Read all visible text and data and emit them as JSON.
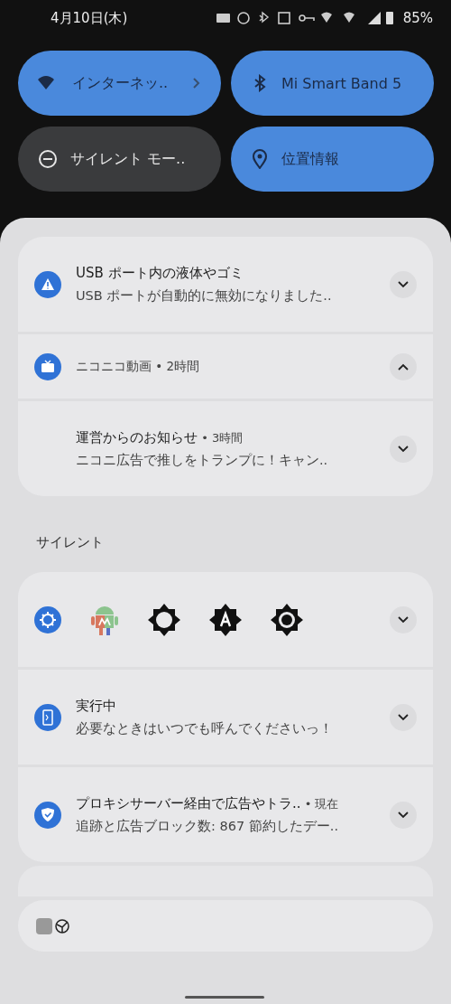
{
  "status_bar": {
    "date": "4月10日(木)",
    "battery": "85%"
  },
  "tiles": [
    {
      "label": "インターネッ..",
      "on": true
    },
    {
      "label": "Mi Smart Band 5",
      "on": true
    },
    {
      "label": "サイレント モー..",
      "on": false
    },
    {
      "label": "位置情報",
      "on": true
    }
  ],
  "alerting": [
    {
      "kind": "single",
      "title": "USB ポート内の液体やゴミ",
      "text": "USB ポートが自動的に無効になりました..",
      "expanded": false
    },
    {
      "kind": "group",
      "header": "ニコニコ動画 • 2時間",
      "expanded": true,
      "children": [
        {
          "title": "運営からのお知らせ",
          "meta": " • 3時間",
          "text": "ニコニ広告で推しをトランプに！キャン..",
          "expanded": false
        }
      ]
    }
  ],
  "silent_label": "サイレント",
  "silent": [
    {
      "kind": "icon_row",
      "expanded": false
    },
    {
      "kind": "single",
      "title": "実行中",
      "text": "必要なときはいつでも呼んでくださいっ！",
      "expanded": false
    },
    {
      "kind": "single",
      "title": "プロキシサーバー経由で広告やトラ..",
      "meta": " • 現在",
      "text": "追跡と広告ブロック数: 867 節約したデー..",
      "expanded": false
    }
  ]
}
